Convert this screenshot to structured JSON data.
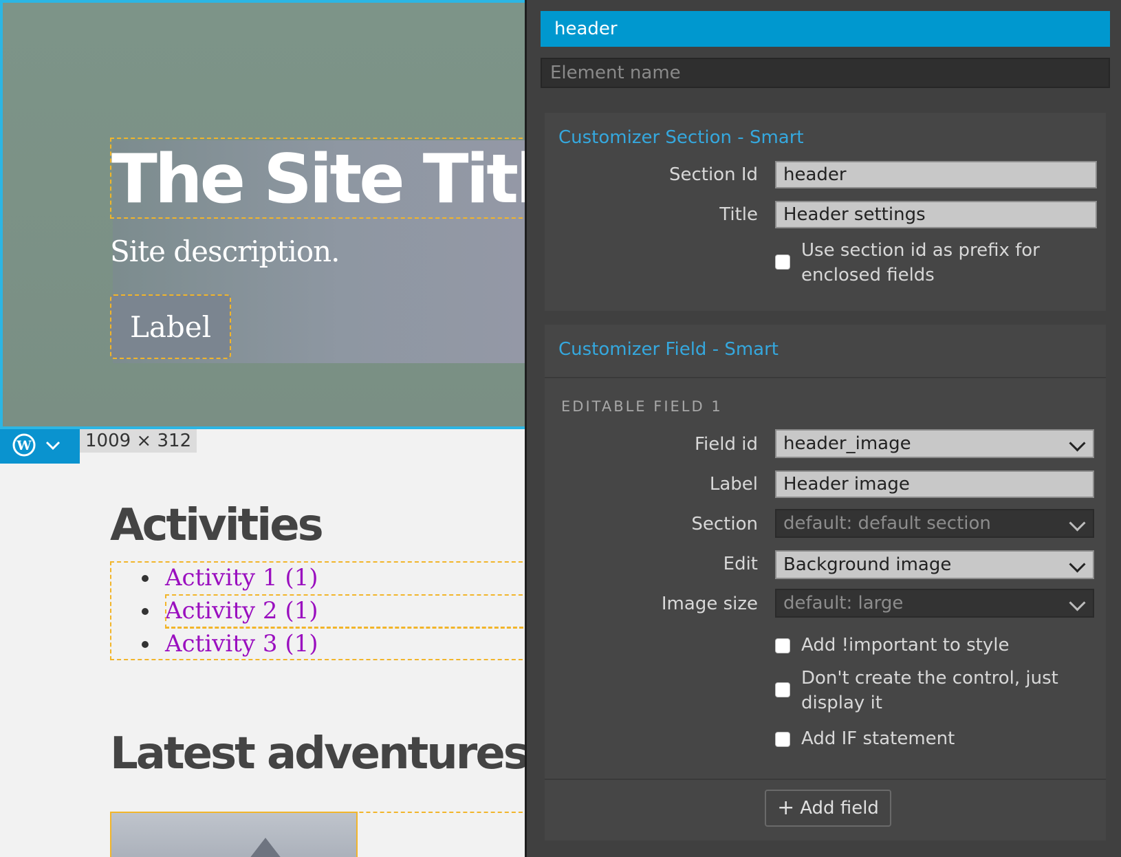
{
  "preview": {
    "site_title": "The Site Title",
    "site_description": "Site description.",
    "hero_button_label": "Label",
    "dimension_badge": "1009 × 312",
    "activities_heading": "Activities",
    "activities": [
      "Activity 1 (1)",
      "Activity 2 (1)",
      "Activity 3 (1)"
    ],
    "latest_heading": "Latest adventures",
    "wp_icon": "wordpress-logo-icon",
    "toolbar_dropdown_icon": "chevron-down-icon"
  },
  "panel": {
    "element_header": "header",
    "element_name_placeholder": "Element name",
    "section_card": {
      "title": "Customizer Section - Smart",
      "section_id_label": "Section Id",
      "section_id_value": "header",
      "title_label": "Title",
      "title_value": "Header settings",
      "prefix_checkbox_label": "Use section id as prefix for enclosed fields"
    },
    "field_card": {
      "title": "Customizer Field - Smart",
      "editable_heading": "EDITABLE FIELD 1",
      "field_id_label": "Field id",
      "field_id_value": "header_image",
      "label_label": "Label",
      "label_value": "Header image",
      "section_label": "Section",
      "section_value": "default: default section",
      "edit_label": "Edit",
      "edit_value": "Background image",
      "image_size_label": "Image size",
      "image_size_value": "default: large",
      "important_label": "Add !important to style",
      "no_control_label": "Don't create the control, just display it",
      "if_label": "Add IF statement",
      "add_field_label": "Add field"
    }
  },
  "colors": {
    "accent_blue": "#0098cf",
    "link_purple": "#9a0fbf",
    "selection_dashed": "#f2b52a",
    "panel_bg": "#404040"
  }
}
